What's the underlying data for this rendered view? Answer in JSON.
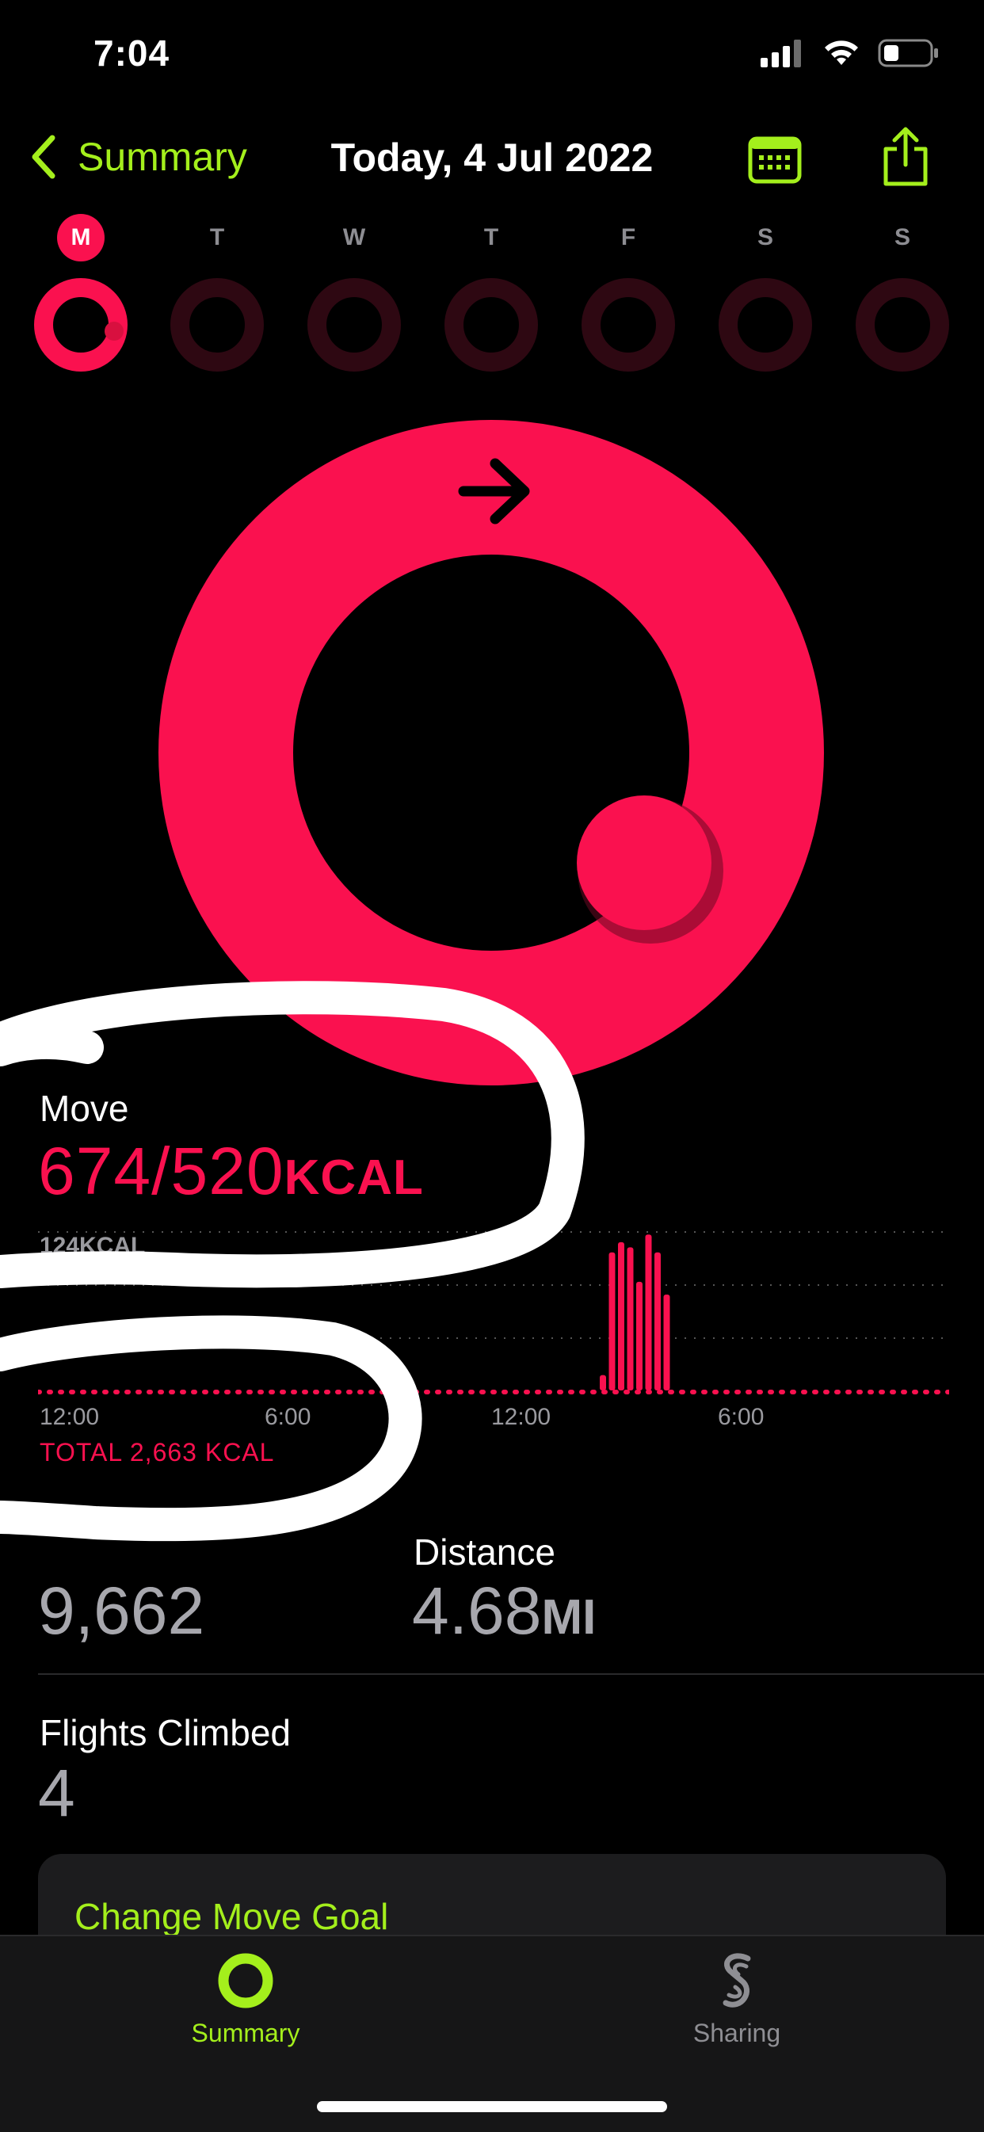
{
  "status_bar": {
    "time": "7:04"
  },
  "nav": {
    "back_label": "Summary",
    "title": "Today, 4 Jul 2022"
  },
  "week": {
    "days": [
      "M",
      "T",
      "W",
      "T",
      "F",
      "S",
      "S"
    ],
    "today_index": 0,
    "today_progress": 1.3
  },
  "move": {
    "label": "Move",
    "value": "674/520",
    "unit": "KCAL",
    "progress": 1.3,
    "chart_max_label": "124KCAL",
    "ticks": [
      "12:00",
      "6:00",
      "12:00",
      "6:00"
    ],
    "total": "TOTAL 2,663 KCAL"
  },
  "steps": {
    "value": "9,662"
  },
  "distance": {
    "label": "Distance",
    "value": "4.68",
    "unit": "MI"
  },
  "flights": {
    "label": "Flights Climbed",
    "value": "4"
  },
  "change_goal": {
    "label": "Change Move Goal"
  },
  "tabbar": {
    "summary_label": "Summary",
    "sharing_label": "Sharing"
  },
  "colors": {
    "move": "#fa114f",
    "accent": "#a4ef1c",
    "background": "#000000"
  },
  "chart_data": {
    "type": "bar",
    "title": "",
    "xlabel": "",
    "ylabel": "",
    "ylim": [
      0,
      124
    ],
    "x_ticks": [
      "12:00",
      "6:00",
      "12:00",
      "6:00"
    ],
    "bar_hours": [
      15.5,
      15.75,
      16.0,
      16.25,
      16.5,
      16.75,
      17.0,
      17.25
    ],
    "values": [
      12,
      108,
      116,
      112,
      85,
      122,
      108,
      75
    ]
  }
}
